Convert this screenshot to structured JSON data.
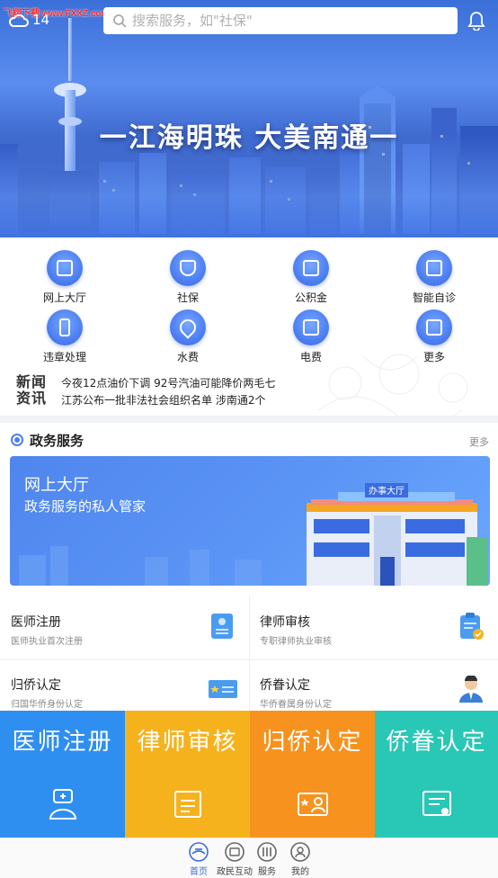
{
  "watermark": "飞翔下载 www.FXXZ.com",
  "status": {
    "weather_temp": "14"
  },
  "search": {
    "placeholder": "搜索服务，如\"社保\""
  },
  "banner": {
    "slogan": "一江海明珠 大美南通一"
  },
  "quick_services": [
    {
      "label": "网上大厅",
      "icon": "monitor-icon"
    },
    {
      "label": "社保",
      "icon": "shield-icon"
    },
    {
      "label": "公积金",
      "icon": "yuan-icon"
    },
    {
      "label": "智能自诊",
      "icon": "medical-kit-icon"
    },
    {
      "label": "违章处理",
      "icon": "traffic-light-icon"
    },
    {
      "label": "水费",
      "icon": "water-drop-icon"
    },
    {
      "label": "电费",
      "icon": "lightning-icon"
    },
    {
      "label": "更多",
      "icon": "plus-icon"
    }
  ],
  "news": {
    "logo_line1": "新闻",
    "logo_line2": "资讯",
    "items": [
      "今夜12点油价下调 92号汽油可能降价两毛七",
      "江苏公布一批非法社会组织名单 涉南通2个"
    ]
  },
  "gov_section": {
    "title": "政务服务",
    "more": "更多",
    "hall_title": "网上大厅",
    "hall_subtitle": "政务服务的私人管家",
    "building_sign": "办事大厅"
  },
  "service_cards": [
    {
      "title": "医师注册",
      "subtitle": "医师执业首次注册",
      "icon": "id-card-icon"
    },
    {
      "title": "律师审核",
      "subtitle": "专职律师执业审核",
      "icon": "clipboard-check-icon"
    },
    {
      "title": "归侨认定",
      "subtitle": "归国华侨身份认定",
      "icon": "id-badge-icon"
    },
    {
      "title": "侨眷认定",
      "subtitle": "华侨眷属身份认定",
      "icon": "person-icon"
    }
  ],
  "tiles": [
    {
      "label": "医师注册",
      "color": "#2f8ff0",
      "icon": "doctor-icon"
    },
    {
      "label": "律师审核",
      "color": "#f6b21d",
      "icon": "document-icon"
    },
    {
      "label": "归侨认定",
      "color": "#f7921e",
      "icon": "photo-id-icon"
    },
    {
      "label": "侨眷认定",
      "color": "#29c7b5",
      "icon": "certificate-icon"
    }
  ],
  "tabbar": [
    {
      "label": "首页",
      "icon": "home-icon",
      "active": true
    },
    {
      "label": "政民互动",
      "icon": "chat-icon",
      "active": false
    },
    {
      "label": "服务",
      "icon": "service-icon",
      "active": false
    },
    {
      "label": "我的",
      "icon": "profile-icon",
      "active": false
    }
  ],
  "colors": {
    "primary": "#4d7ff2",
    "tab_active": "#3a6be0"
  }
}
